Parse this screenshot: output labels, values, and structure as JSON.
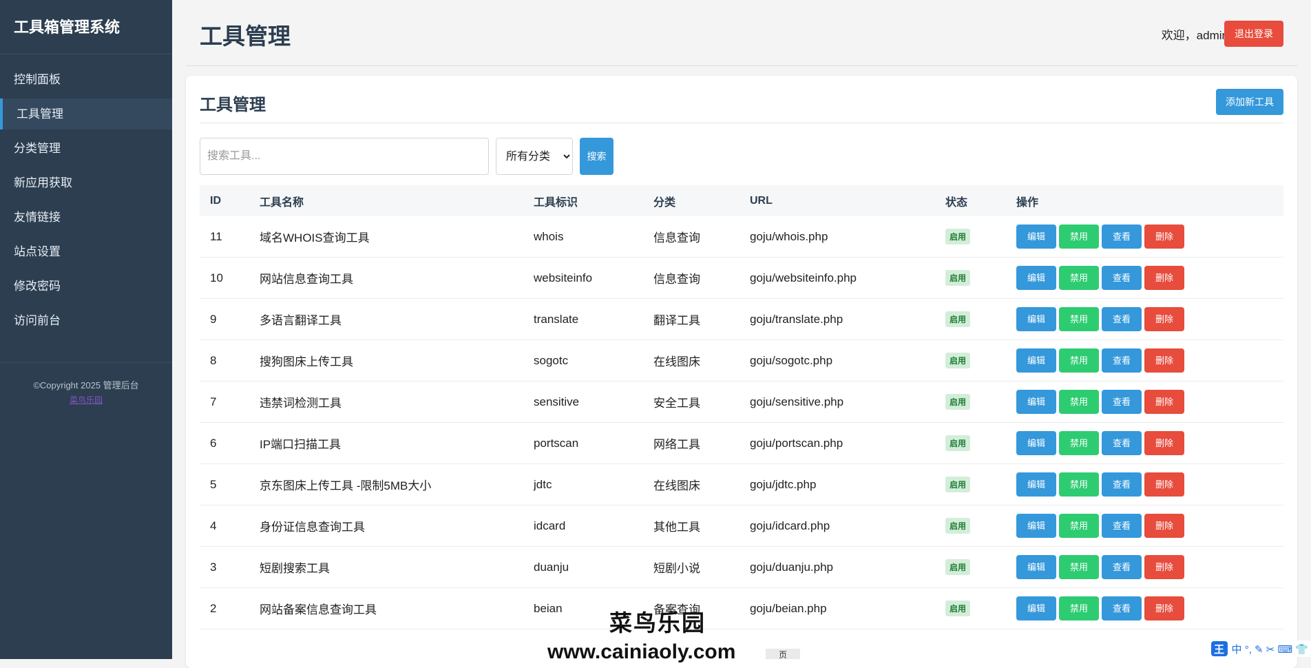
{
  "sidebar": {
    "brand": "工具箱管理系统",
    "items": [
      {
        "label": "控制面板"
      },
      {
        "label": "工具管理"
      },
      {
        "label": "分类管理"
      },
      {
        "label": "新应用获取"
      },
      {
        "label": "友情链接"
      },
      {
        "label": "站点设置"
      },
      {
        "label": "修改密码"
      },
      {
        "label": "访问前台"
      }
    ],
    "active_index": 1,
    "copyright": "©Copyright 2025 管理后台",
    "copyright_link": "菜鸟乐园"
  },
  "header": {
    "title": "工具管理",
    "welcome": "欢迎，admin",
    "logout_label": "退出登录"
  },
  "card": {
    "title": "工具管理",
    "add_label": "添加新工具",
    "search_placeholder": "搜索工具...",
    "category_selected": "所有分类",
    "search_label": "搜索"
  },
  "table": {
    "headers": [
      "ID",
      "工具名称",
      "工具标识",
      "分类",
      "URL",
      "状态",
      "操作"
    ],
    "action_labels": {
      "edit": "编辑",
      "disable": "禁用",
      "view": "查看",
      "delete": "删除"
    },
    "rows": [
      {
        "id": "11",
        "name": "域名WHOIS查询工具",
        "key": "whois",
        "category": "信息查询",
        "url": "goju/whois.php",
        "status": "启用"
      },
      {
        "id": "10",
        "name": "网站信息查询工具",
        "key": "websiteinfo",
        "category": "信息查询",
        "url": "goju/websiteinfo.php",
        "status": "启用"
      },
      {
        "id": "9",
        "name": "多语言翻译工具",
        "key": "translate",
        "category": "翻译工具",
        "url": "goju/translate.php",
        "status": "启用"
      },
      {
        "id": "8",
        "name": "搜狗图床上传工具",
        "key": "sogotc",
        "category": "在线图床",
        "url": "goju/sogotc.php",
        "status": "启用"
      },
      {
        "id": "7",
        "name": "违禁词检测工具",
        "key": "sensitive",
        "category": "安全工具",
        "url": "goju/sensitive.php",
        "status": "启用"
      },
      {
        "id": "6",
        "name": "IP端口扫描工具",
        "key": "portscan",
        "category": "网络工具",
        "url": "goju/portscan.php",
        "status": "启用"
      },
      {
        "id": "5",
        "name": "京东图床上传工具 -限制5MB大小",
        "key": "jdtc",
        "category": "在线图床",
        "url": "goju/jdtc.php",
        "status": "启用"
      },
      {
        "id": "4",
        "name": "身份证信息查询工具",
        "key": "idcard",
        "category": "其他工具",
        "url": "goju/idcard.php",
        "status": "启用"
      },
      {
        "id": "3",
        "name": "短剧搜索工具",
        "key": "duanju",
        "category": "短剧小说",
        "url": "goju/duanju.php",
        "status": "启用"
      },
      {
        "id": "2",
        "name": "网站备案信息查询工具",
        "key": "beian",
        "category": "备案查询",
        "url": "goju/beian.php",
        "status": "启用"
      }
    ]
  },
  "overlay": {
    "watermark": "菜鸟乐园",
    "watermark_url": "www.cainiaoly.com",
    "pager_fragment": "页",
    "ime_glyph": "王",
    "ime_items": "中 °, ✎ ✂ ⌨ 👕"
  },
  "colors": {
    "sidebar": "#2c3e50",
    "primary": "#3498db",
    "success": "#2ecc71",
    "danger": "#e74c3c"
  }
}
